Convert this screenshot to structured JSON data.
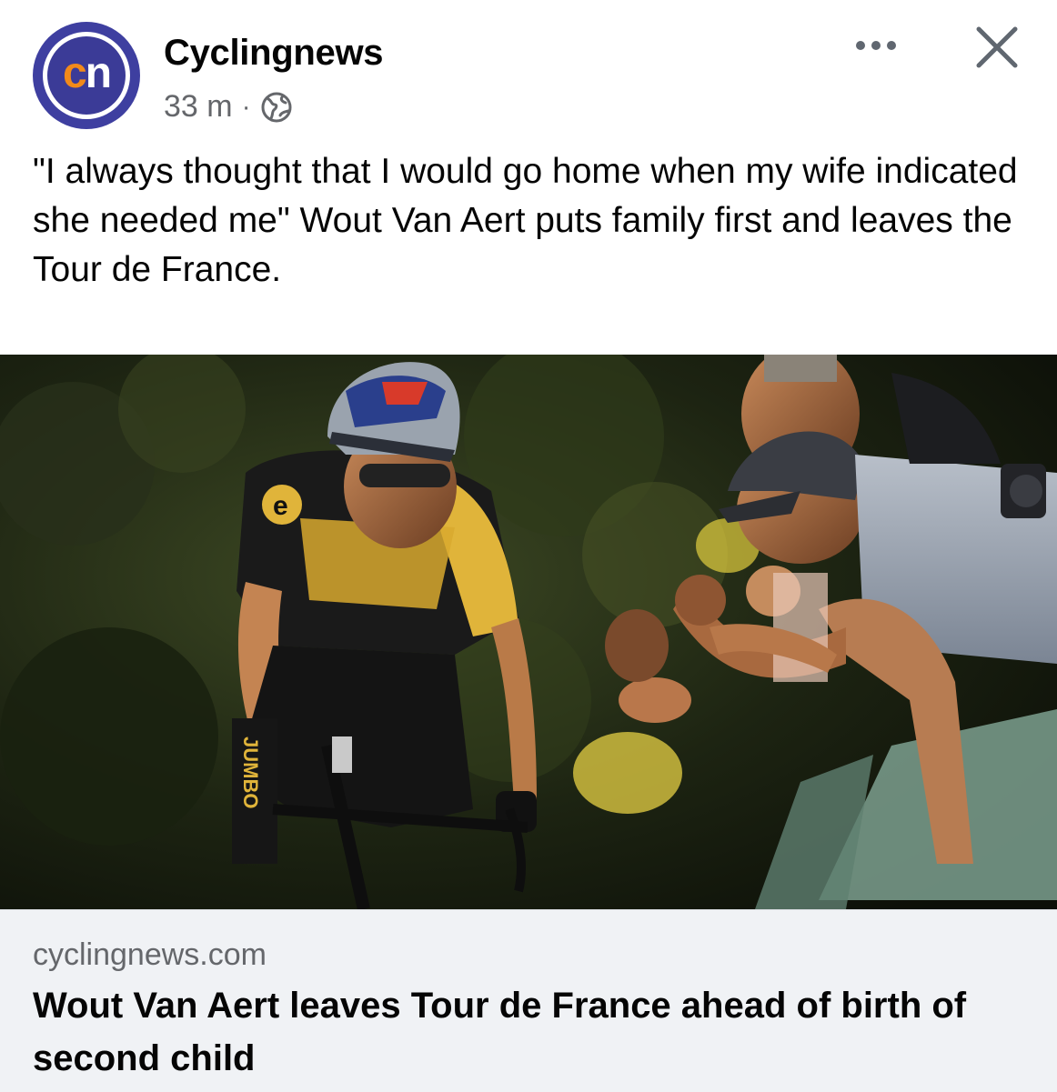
{
  "post": {
    "page_name": "Cyclingnews",
    "avatar": {
      "letters_c": "c",
      "letters_n": "n",
      "brand_orange": "#f28a1a",
      "brand_purple": "#3b3b97"
    },
    "timestamp": "33 m",
    "separator": "·",
    "audience_icon": "globe-icon",
    "more_icon": "more-dots-icon",
    "close_icon": "close-icon",
    "caption": "\"I always thought that I would go home when my wife indicated she needed me\" Wout Van Aert puts family first and leaves the Tour de France."
  },
  "photo": {
    "description_icon": "article-photo"
  },
  "link_preview": {
    "domain": "cyclingnews.com",
    "title": "Wout Van Aert leaves Tour de France ahead of birth of second child"
  }
}
